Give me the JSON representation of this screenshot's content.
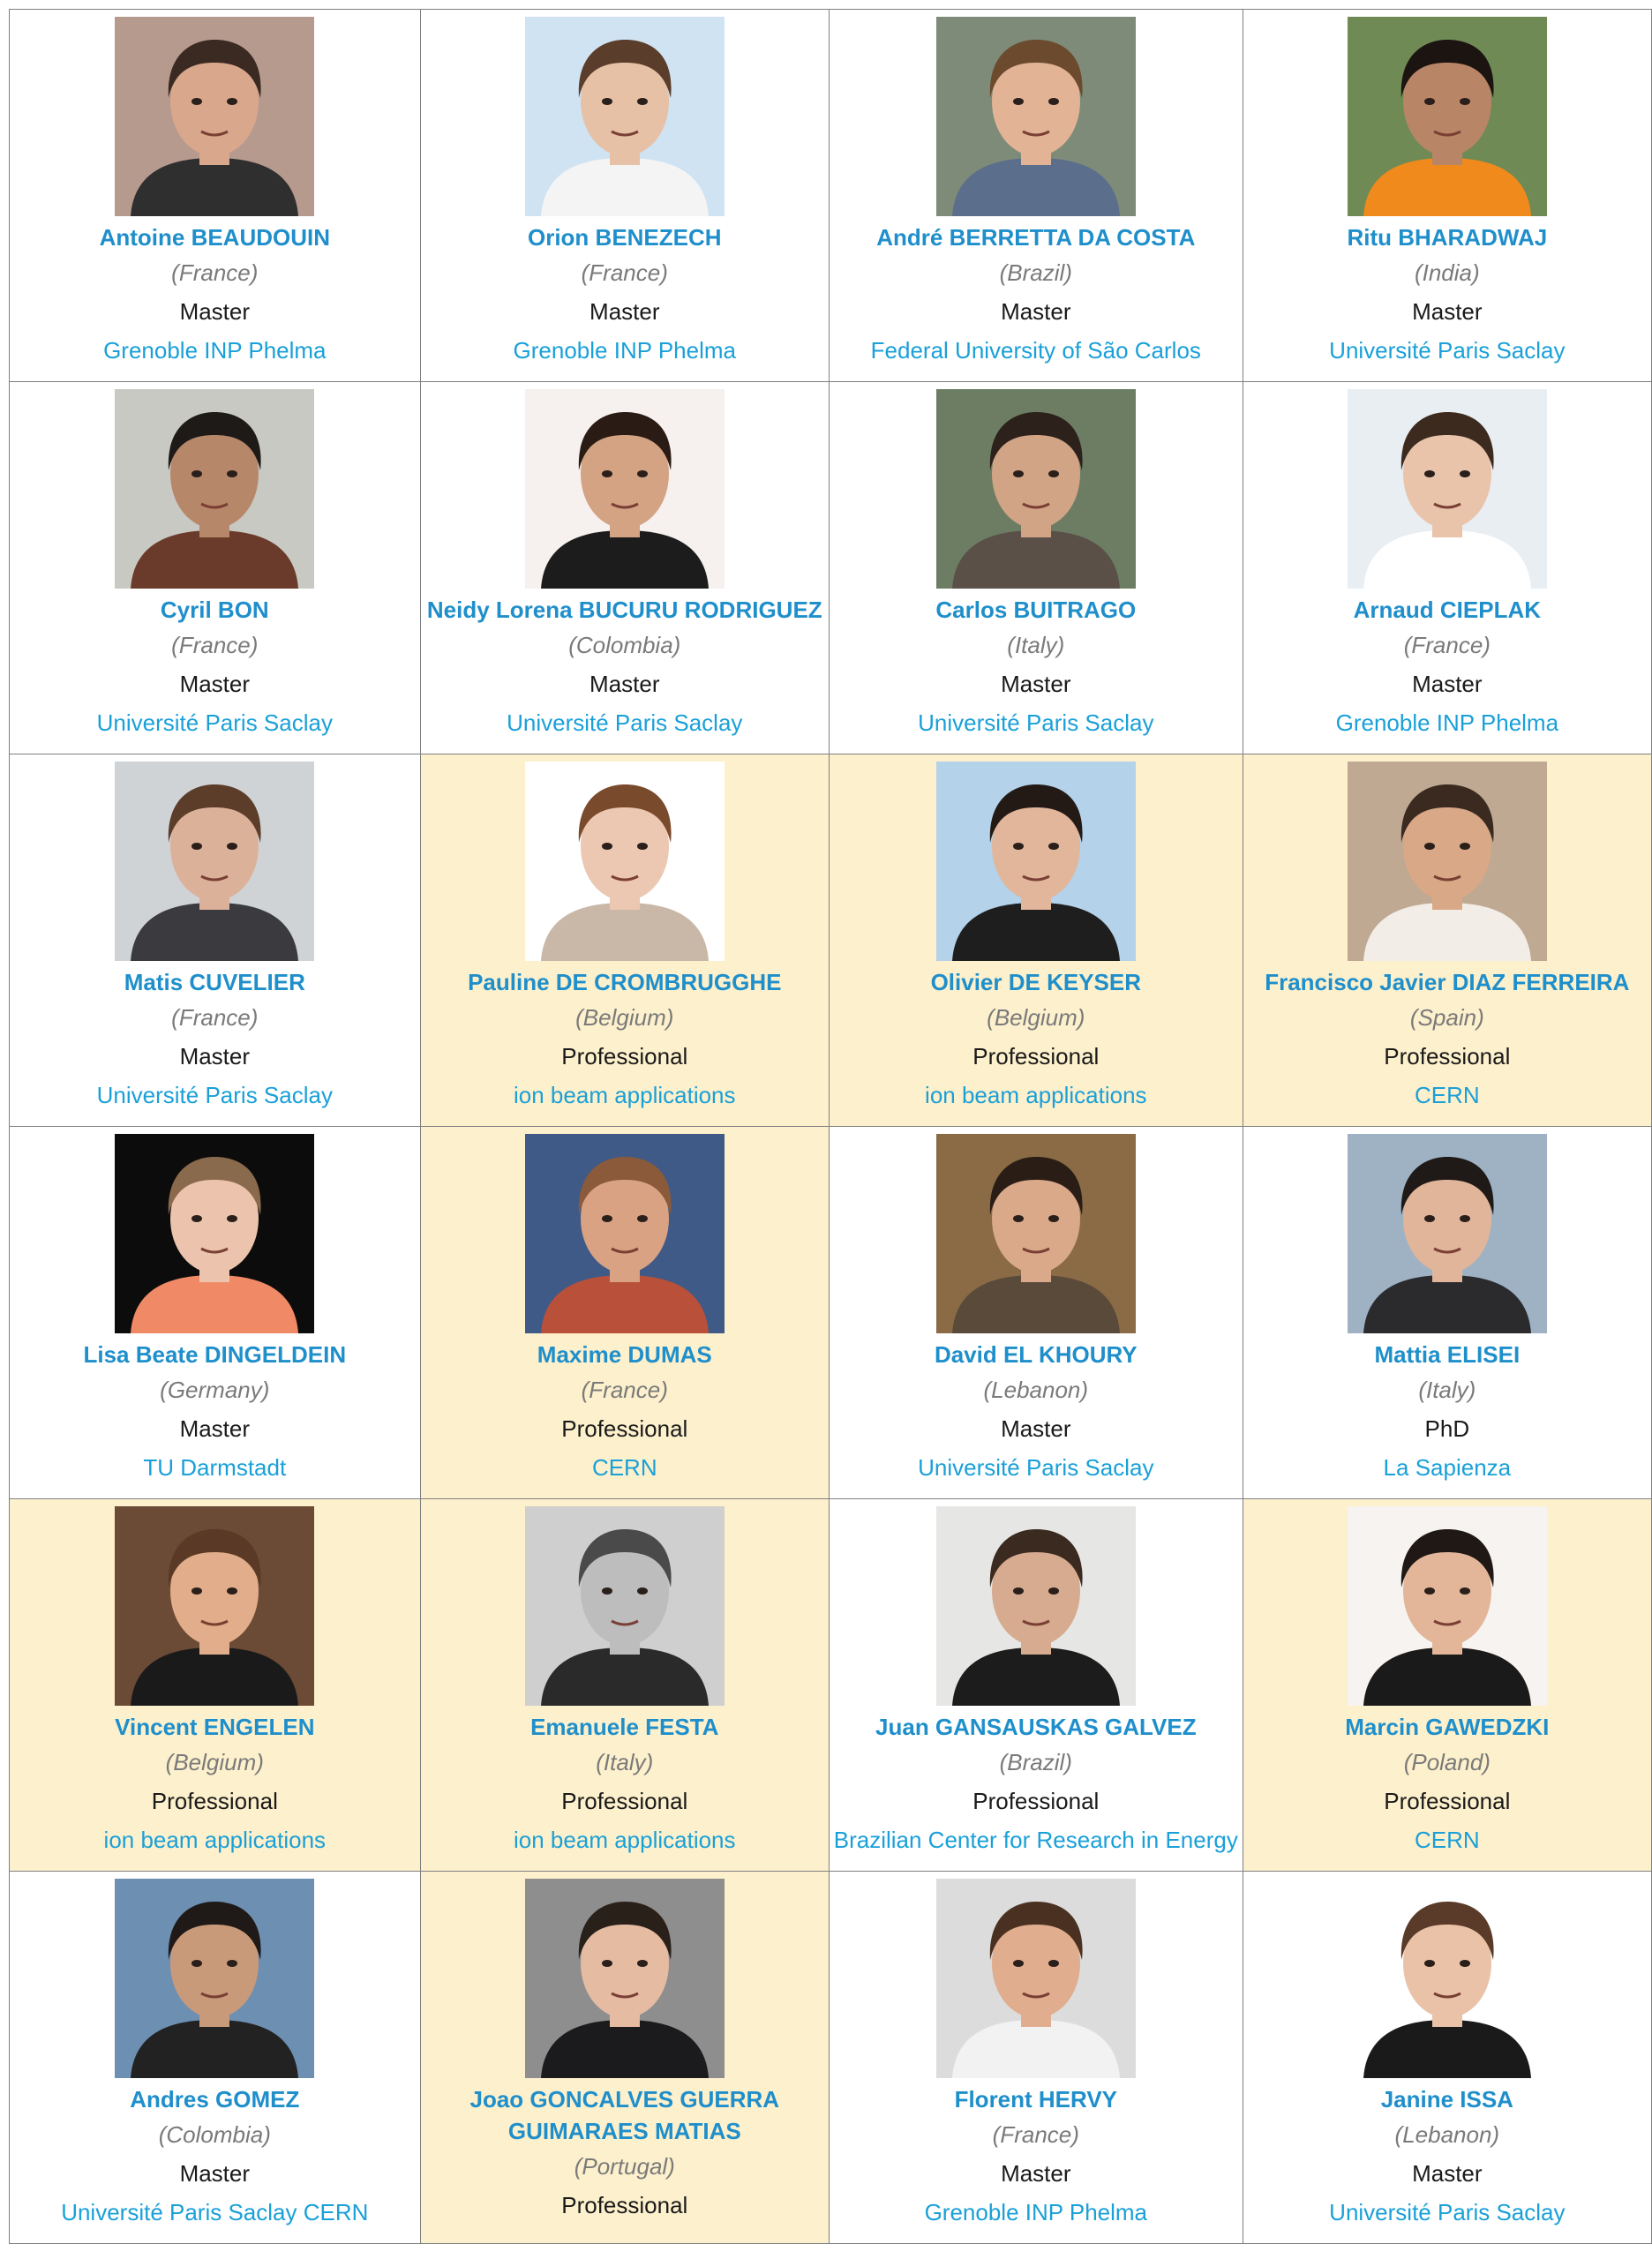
{
  "participants": [
    {
      "name": "Antoine BEAUDOUIN",
      "country": "(France)",
      "level": "Master",
      "institution": "Grenoble INP Phelma",
      "bg": "#b79a8e",
      "skin": "#d9a78c",
      "hair": "#3a2a22",
      "shirt": "#2f2f2f",
      "highlight": false
    },
    {
      "name": "Orion BENEZECH",
      "country": "(France)",
      "level": "Master",
      "institution": "Grenoble INP Phelma",
      "bg": "#cfe3f3",
      "skin": "#e7c1a6",
      "hair": "#5a3e2b",
      "shirt": "#f4f4f4",
      "highlight": false
    },
    {
      "name": "André BERRETTA DA COSTA",
      "country": "(Brazil)",
      "level": "Master",
      "institution": "Federal University of São Carlos",
      "bg": "#7d8b78",
      "skin": "#e2b394",
      "hair": "#6b4a2e",
      "shirt": "#5b6e8c",
      "highlight": false
    },
    {
      "name": "Ritu BHARADWAJ",
      "country": "(India)",
      "level": "Master",
      "institution": "Université Paris Saclay",
      "bg": "#6f8a55",
      "skin": "#b98567",
      "hair": "#1c1410",
      "shirt": "#f08a1c",
      "highlight": false
    },
    {
      "name": "Cyril BON",
      "country": "(France)",
      "level": "Master",
      "institution": "Université Paris Saclay",
      "bg": "#c9c9c4",
      "skin": "#b7876a",
      "hair": "#1d1a18",
      "shirt": "#6a3b2a",
      "highlight": false
    },
    {
      "name": "Neidy Lorena BUCURU RODRIGUEZ",
      "country": "(Colombia)",
      "level": "Master",
      "institution": "Université Paris Saclay",
      "bg": "#f6f1ee",
      "skin": "#d3a384",
      "hair": "#2a1c14",
      "shirt": "#1c1c1c",
      "highlight": false
    },
    {
      "name": "Carlos BUITRAGO",
      "country": "(Italy)",
      "level": "Master",
      "institution": "Université Paris Saclay",
      "bg": "#6c7d63",
      "skin": "#d2a486",
      "hair": "#2c211b",
      "shirt": "#5a5048",
      "highlight": false
    },
    {
      "name": "Arnaud CIEPLAK",
      "country": "(France)",
      "level": "Master",
      "institution": "Grenoble INP Phelma",
      "bg": "#e8eef2",
      "skin": "#e9c4ab",
      "hair": "#3c2a1f",
      "shirt": "#ffffff",
      "highlight": false
    },
    {
      "name": "Matis CUVELIER",
      "country": "(France)",
      "level": "Master",
      "institution": "Université Paris Saclay",
      "bg": "#cfd3d6",
      "skin": "#dcb19a",
      "hair": "#5b3d29",
      "shirt": "#3b3b3f",
      "highlight": false
    },
    {
      "name": "Pauline DE CROMBRUGGHE",
      "country": "(Belgium)",
      "level": "Professional",
      "institution": "ion beam applications",
      "bg": "#ffffff",
      "skin": "#ecc7b1",
      "hair": "#7a4a2c",
      "shirt": "#c9b8a8",
      "highlight": true
    },
    {
      "name": "Olivier DE KEYSER",
      "country": "(Belgium)",
      "level": "Professional",
      "institution": "ion beam applications",
      "bg": "#b4d2ea",
      "skin": "#e1b69b",
      "hair": "#231a16",
      "shirt": "#1e1e1e",
      "highlight": true
    },
    {
      "name": "Francisco Javier DIAZ FERREIRA",
      "country": "(Spain)",
      "level": "Professional",
      "institution": "CERN",
      "bg": "#bfa993",
      "skin": "#d8a887",
      "hair": "#3b2a20",
      "shirt": "#f2ede6",
      "highlight": true
    },
    {
      "name": "Lisa Beate DINGELDEIN",
      "country": "(Germany)",
      "level": "Master",
      "institution": "TU Darmstadt",
      "bg": "#0c0c0c",
      "skin": "#ecc4ad",
      "hair": "#8a6a4c",
      "shirt": "#f08a66",
      "highlight": false
    },
    {
      "name": "Maxime DUMAS",
      "country": "(France)",
      "level": "Professional",
      "institution": "CERN",
      "bg": "#3f5a86",
      "skin": "#d9a282",
      "hair": "#8a5a3a",
      "shirt": "#b8503a",
      "highlight": true
    },
    {
      "name": "David EL KHOURY",
      "country": "(Lebanon)",
      "level": "Master",
      "institution": "Université Paris Saclay",
      "bg": "#8a6b45",
      "skin": "#d9a98a",
      "hair": "#2a1d16",
      "shirt": "#5a4a3a",
      "highlight": false
    },
    {
      "name": "Mattia ELISEI",
      "country": "(Italy)",
      "level": "PhD",
      "institution": "La Sapienza",
      "bg": "#9fb2c4",
      "skin": "#e0b59a",
      "hair": "#1f1a17",
      "shirt": "#2b2b2e",
      "highlight": false
    },
    {
      "name": "Vincent ENGELEN",
      "country": "(Belgium)",
      "level": "Professional",
      "institution": "ion beam applications",
      "bg": "#6b4a36",
      "skin": "#e2ad8a",
      "hair": "#5a3a26",
      "shirt": "#1a1a1a",
      "highlight": true
    },
    {
      "name": "Emanuele FESTA",
      "country": "(Italy)",
      "level": "Professional",
      "institution": "ion beam applications",
      "bg": "#cfcfcf",
      "skin": "#bdbdbd",
      "hair": "#4a4a4a",
      "shirt": "#2a2a2a",
      "highlight": true
    },
    {
      "name": "Juan GANSAUSKAS GALVEZ",
      "country": "(Brazil)",
      "level": "Professional",
      "institution": "Brazilian Center for Research in Energy",
      "bg": "#e6e6e4",
      "skin": "#d7ab8f",
      "hair": "#3a2a20",
      "shirt": "#1c1c1c",
      "highlight": false
    },
    {
      "name": "Marcin GAWEDZKI",
      "country": "(Poland)",
      "level": "Professional",
      "institution": "CERN",
      "bg": "#f6f3f0",
      "skin": "#e3b69a",
      "hair": "#1f1815",
      "shirt": "#1a1a1a",
      "highlight": true
    },
    {
      "name": "Andres GOMEZ",
      "country": "(Colombia)",
      "level": "Master",
      "institution": "Université Paris Saclay CERN",
      "bg": "#6d8fb2",
      "skin": "#c99a7a",
      "hair": "#1f1a17",
      "shirt": "#222222",
      "highlight": false
    },
    {
      "name": "Joao GONCALVES GUERRA GUIMARAES MATIAS",
      "country": "(Portugal)",
      "level": "Professional",
      "institution": "",
      "bg": "#8e8e8e",
      "skin": "#e5bba2",
      "hair": "#2a201a",
      "shirt": "#1b1b1e",
      "highlight": true
    },
    {
      "name": "Florent HERVY",
      "country": "(France)",
      "level": "Master",
      "institution": "Grenoble INP Phelma",
      "bg": "#dcdcdc",
      "skin": "#e0ad8e",
      "hair": "#4a3020",
      "shirt": "#f2f2f2",
      "highlight": false
    },
    {
      "name": "Janine ISSA",
      "country": "(Lebanon)",
      "level": "Master",
      "institution": "Université Paris Saclay",
      "bg": "#ffffff",
      "skin": "#e9c2a8",
      "hair": "#5a3a28",
      "shirt": "#1a1a1a",
      "highlight": false
    }
  ]
}
